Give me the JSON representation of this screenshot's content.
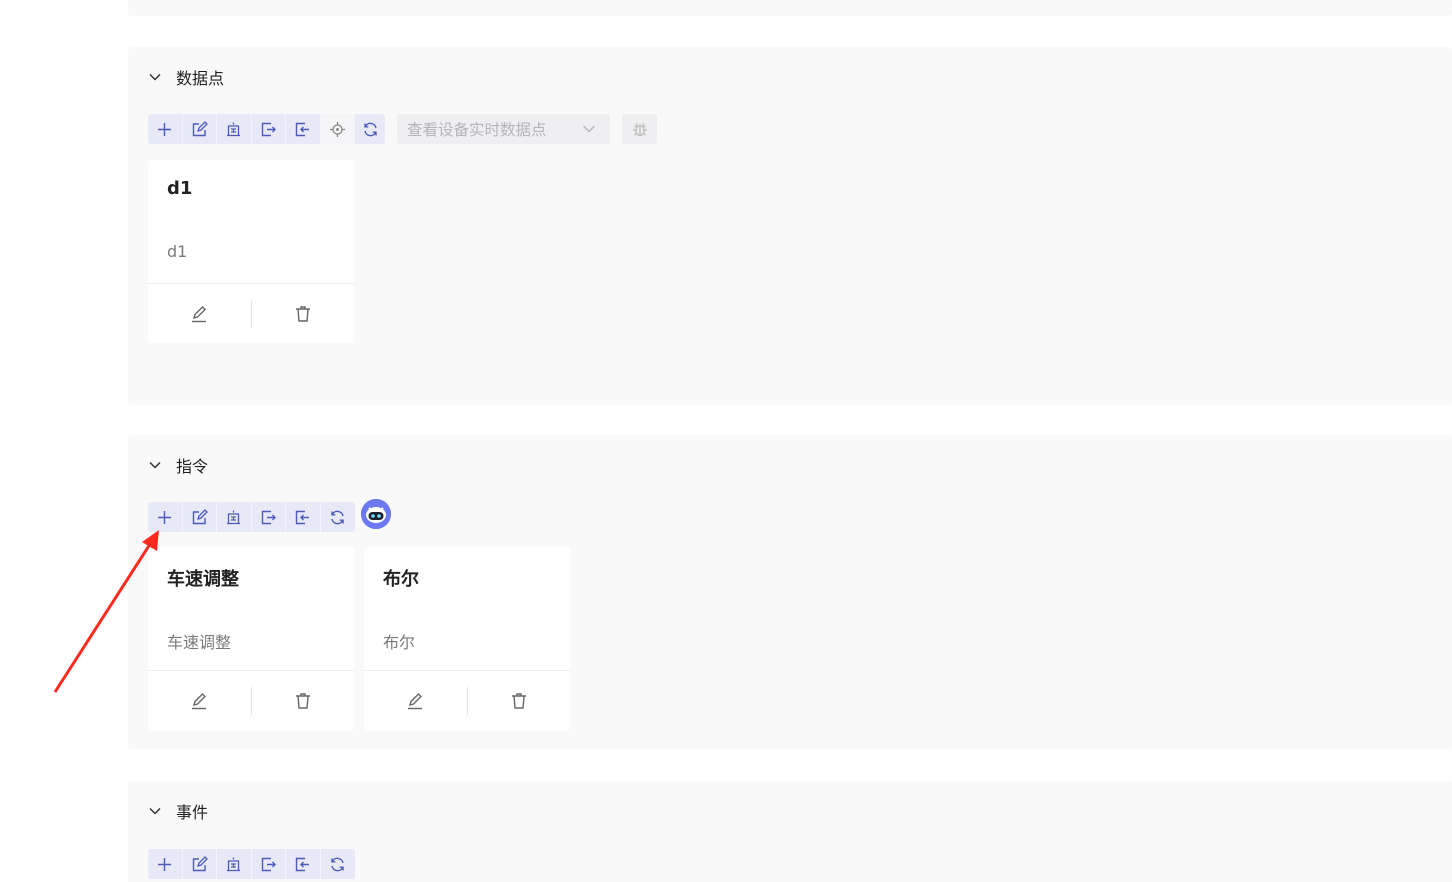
{
  "colors": {
    "section_bg": "#f9f9fa",
    "toolbar_bg": "#e7e9f7",
    "icon_accent": "#4d5ab8",
    "annotation_arrow": "#ff2a1f"
  },
  "sections": {
    "datapoints": {
      "title": "数据点",
      "select_placeholder": "查看设备实时数据点",
      "cards": [
        {
          "title": "d1",
          "desc": "d1"
        }
      ]
    },
    "commands": {
      "title": "指令",
      "cards": [
        {
          "title": "车速调整",
          "desc": "车速调整"
        },
        {
          "title": "布尔",
          "desc": "布尔"
        }
      ]
    },
    "events": {
      "title": "事件"
    }
  },
  "icons": {
    "toolbar": [
      "plus-icon",
      "edit-icon",
      "bank-icon",
      "export-icon",
      "import-icon",
      "target-icon",
      "refresh-icon"
    ],
    "card_actions": [
      "pencil-icon",
      "trash-icon"
    ],
    "extra": [
      "chevron-down-icon",
      "bug-icon",
      "robot-avatar-icon"
    ]
  }
}
